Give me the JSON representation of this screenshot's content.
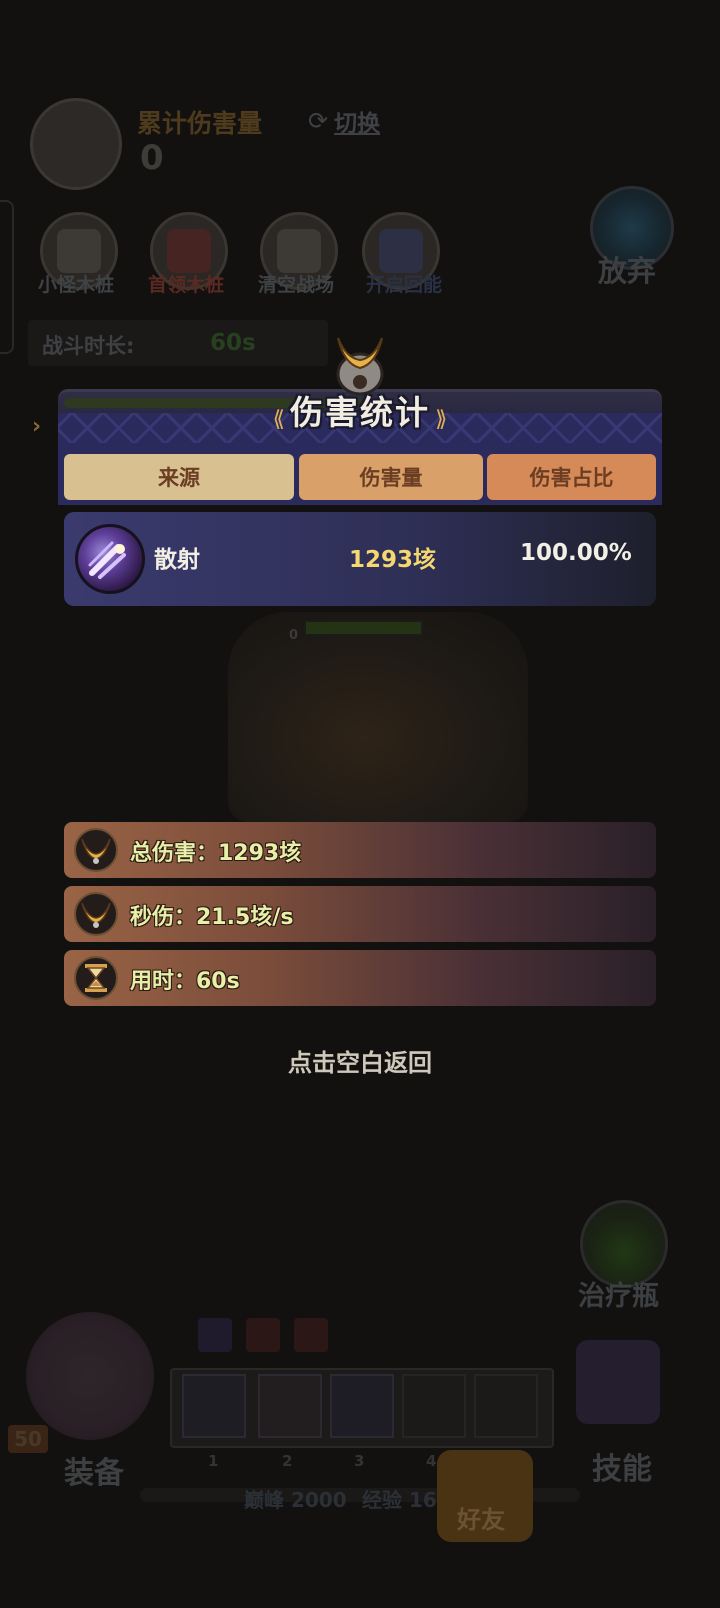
{
  "background": {
    "damage_label": "累计伤害量",
    "damage_value": "0",
    "switch_label": "切换",
    "buttons": [
      {
        "label": "小怪木桩",
        "color": "#3f4346"
      },
      {
        "label": "首领木桩",
        "color": "#5a2a22"
      },
      {
        "label": "清空战场",
        "color": "#3f4346"
      },
      {
        "label": "开启回能",
        "color": "#2a3146"
      }
    ],
    "abandon_label": "放弃",
    "battle_time_label": "战斗时长:",
    "battle_time_value": "60s",
    "potion_label": "治疗瓶",
    "equip_label": "装备",
    "skill_label": "技能",
    "level_badge": "50",
    "slot_numbers": [
      "1",
      "2",
      "3",
      "4"
    ],
    "peak_label": "巅峰 2000",
    "exp_label": "经验 167",
    "friends_label": "好友",
    "boss_hp_value": "0"
  },
  "modal": {
    "title": "伤害统计",
    "columns": [
      "来源",
      "伤害量",
      "伤害占比"
    ],
    "rows": [
      {
        "icon": "scatter-shot-icon",
        "source": "散射",
        "damage": "1293垓",
        "percent": "100.00%"
      }
    ],
    "stats": [
      {
        "icon": "crown-icon",
        "text": "总伤害：1293垓"
      },
      {
        "icon": "crown-icon",
        "text": "秒伤：21.5垓/s"
      },
      {
        "icon": "hourglass-icon",
        "text": "用时：60s"
      }
    ],
    "return_hint": "点击空白返回"
  },
  "colors": {
    "col_source_bg": "#d8c090",
    "col_damage_bg": "#d9a06a",
    "col_percent_bg": "#d68a58",
    "damage_value_color": "#f5d870",
    "percent_value_color": "#f2efe4",
    "stat_text_color": "#e8f0a8"
  }
}
